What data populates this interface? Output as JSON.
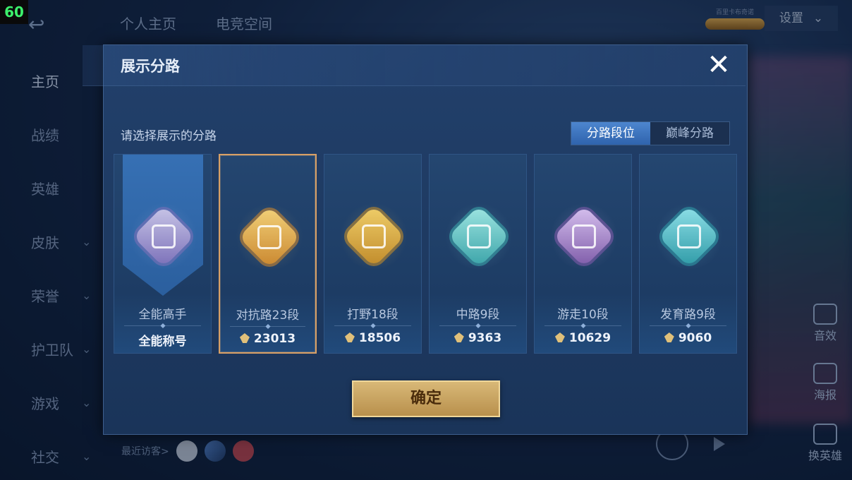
{
  "status": {
    "fps": "60"
  },
  "topbar": {
    "tabs": [
      "个人主页",
      "电竞空间"
    ],
    "badge_text": "百里卡布奇诺",
    "settings_label": "设置"
  },
  "sidebar": {
    "items": [
      {
        "label": "主页",
        "active": true,
        "has_chevron": false
      },
      {
        "label": "战绩",
        "has_chevron": false
      },
      {
        "label": "英雄",
        "has_chevron": false
      },
      {
        "label": "皮肤",
        "has_chevron": true
      },
      {
        "label": "荣誉",
        "has_chevron": true
      },
      {
        "label": "护卫队",
        "has_chevron": true
      },
      {
        "label": "游戏",
        "has_chevron": true
      },
      {
        "label": "社交",
        "has_chevron": true
      }
    ]
  },
  "visitors_label": "最近访客>",
  "right_side": {
    "item1": "音效",
    "item2": "海报",
    "item3": "换英雄"
  },
  "modal": {
    "title": "展示分路",
    "prompt": "请选择展示的分路",
    "toggle": [
      {
        "label": "分路段位",
        "active": true
      },
      {
        "label": "巅峰分路",
        "active": false
      }
    ],
    "cards": [
      {
        "name": "全能高手",
        "score": "全能称号",
        "score_icon": false,
        "selected": false,
        "emblem_color": "#7a6fb8",
        "emblem_accent": "#c9c6e8"
      },
      {
        "name": "对抗路23段",
        "score": "23013",
        "score_icon": true,
        "selected": true,
        "emblem_color": "#c9862e",
        "emblem_accent": "#f3d27a"
      },
      {
        "name": "打野18段",
        "score": "18506",
        "score_icon": true,
        "selected": false,
        "emblem_color": "#c08a2a",
        "emblem_accent": "#f0cf6a"
      },
      {
        "name": "中路9段",
        "score": "9363",
        "score_icon": true,
        "selected": false,
        "emblem_color": "#3aa3a8",
        "emblem_accent": "#9fe6e2"
      },
      {
        "name": "游走10段",
        "score": "10629",
        "score_icon": true,
        "selected": false,
        "emblem_color": "#7d5aa8",
        "emblem_accent": "#d8c2f0"
      },
      {
        "name": "发育路9段",
        "score": "9060",
        "score_icon": true,
        "selected": false,
        "emblem_color": "#2e9aa6",
        "emblem_accent": "#8fe0e8"
      }
    ],
    "confirm_label": "确定"
  }
}
